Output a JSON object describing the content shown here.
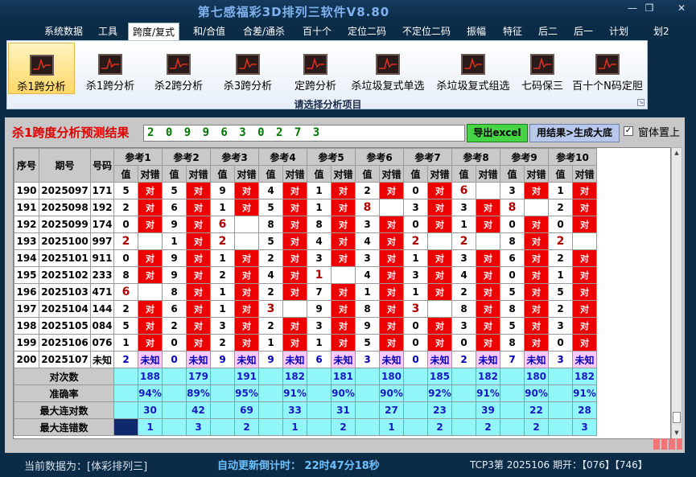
{
  "window": {
    "title": "第七感福彩3D排列三软件V8.80",
    "min": "—",
    "max": "❐",
    "close": "✕"
  },
  "menu": [
    "系统数据",
    "工具",
    "跨度/复式",
    "和/合值",
    "合差/通杀",
    "百十个",
    "定位二码",
    "不定位二码",
    "振幅",
    "特征",
    "后二",
    "后一",
    "计划",
    "划2"
  ],
  "menu_active": 2,
  "ribbon": {
    "buttons": [
      "杀1跨分析",
      "杀1跨分析",
      "杀2跨分析",
      "杀3跨分析",
      "定跨分析",
      "杀垃圾复式单选",
      "杀垃圾复式组选",
      "七码保三",
      "百十个N码定胆"
    ],
    "active": 0,
    "caption": "请选择分析项目",
    "icon": "chart-icon"
  },
  "result": {
    "label": "杀1跨度分析预测结果",
    "value": "2 0 9 9 6 3 0 2 7 3",
    "excel_button": "导出excel",
    "generate_button": "用结果>生成大底",
    "ontop_label": "窗体置上",
    "ontop_checked": "✓"
  },
  "table": {
    "col_headers": [
      "序号",
      "期号",
      "号码"
    ],
    "refs": [
      "参考1",
      "参考2",
      "参考3",
      "参考4",
      "参考5",
      "参考6",
      "参考7",
      "参考8",
      "参考9",
      "参考10"
    ],
    "sub_headers": [
      "值",
      "对错"
    ],
    "hit_text": "对",
    "unknown_text": "未知",
    "rows": [
      {
        "seq": "190",
        "period": "2025097",
        "number": "171",
        "vals": [
          "5",
          "5",
          "9",
          "4",
          "1",
          "2",
          "0",
          "6",
          "3",
          "1"
        ],
        "hits": [
          1,
          1,
          1,
          1,
          1,
          1,
          1,
          0,
          1,
          1
        ]
      },
      {
        "seq": "191",
        "period": "2025098",
        "number": "192",
        "vals": [
          "2",
          "6",
          "1",
          "5",
          "1",
          "8",
          "3",
          "3",
          "8",
          "2"
        ],
        "hits": [
          1,
          1,
          1,
          1,
          1,
          0,
          1,
          1,
          0,
          1
        ]
      },
      {
        "seq": "192",
        "period": "2025099",
        "number": "174",
        "vals": [
          "0",
          "9",
          "6",
          "8",
          "8",
          "3",
          "0",
          "1",
          "0",
          "0"
        ],
        "hits": [
          1,
          1,
          0,
          1,
          1,
          1,
          1,
          1,
          1,
          1
        ]
      },
      {
        "seq": "193",
        "period": "2025100",
        "number": "997",
        "vals": [
          "2",
          "1",
          "2",
          "5",
          "4",
          "4",
          "2",
          "2",
          "8",
          "2"
        ],
        "hits": [
          0,
          1,
          0,
          1,
          1,
          1,
          0,
          0,
          1,
          0
        ]
      },
      {
        "seq": "194",
        "period": "2025101",
        "number": "911",
        "vals": [
          "0",
          "9",
          "1",
          "2",
          "3",
          "3",
          "1",
          "3",
          "6",
          "2"
        ],
        "hits": [
          1,
          1,
          1,
          1,
          1,
          1,
          1,
          1,
          1,
          1
        ]
      },
      {
        "seq": "195",
        "period": "2025102",
        "number": "233",
        "vals": [
          "8",
          "9",
          "2",
          "4",
          "1",
          "4",
          "3",
          "4",
          "0",
          "1"
        ],
        "hits": [
          1,
          1,
          1,
          1,
          0,
          1,
          1,
          1,
          1,
          1
        ]
      },
      {
        "seq": "196",
        "period": "2025103",
        "number": "471",
        "vals": [
          "6",
          "8",
          "1",
          "2",
          "7",
          "1",
          "1",
          "2",
          "5",
          "5"
        ],
        "hits": [
          0,
          1,
          1,
          1,
          1,
          1,
          1,
          1,
          1,
          1
        ]
      },
      {
        "seq": "197",
        "period": "2025104",
        "number": "144",
        "vals": [
          "2",
          "6",
          "1",
          "3",
          "9",
          "8",
          "3",
          "8",
          "8",
          "2"
        ],
        "hits": [
          1,
          1,
          1,
          0,
          1,
          1,
          0,
          1,
          1,
          1
        ]
      },
      {
        "seq": "198",
        "period": "2025105",
        "number": "084",
        "vals": [
          "5",
          "2",
          "3",
          "2",
          "3",
          "9",
          "0",
          "3",
          "5",
          "3"
        ],
        "hits": [
          1,
          1,
          1,
          1,
          1,
          1,
          1,
          1,
          1,
          1
        ]
      },
      {
        "seq": "199",
        "period": "2025106",
        "number": "076",
        "vals": [
          "1",
          "0",
          "2",
          "1",
          "1",
          "5",
          "0",
          "0",
          "8",
          "0"
        ],
        "hits": [
          1,
          1,
          1,
          1,
          1,
          1,
          1,
          1,
          1,
          1
        ]
      }
    ],
    "unknown_row": {
      "seq": "200",
      "period": "2025107",
      "number": "未知",
      "vals": [
        "2",
        "0",
        "9",
        "9",
        "6",
        "3",
        "0",
        "2",
        "7",
        "3"
      ]
    },
    "stats": [
      {
        "label": "对次数",
        "values": [
          "188",
          "179",
          "191",
          "182",
          "181",
          "180",
          "185",
          "182",
          "180",
          "182"
        ]
      },
      {
        "label": "准确率",
        "values": [
          "94%",
          "89%",
          "95%",
          "91%",
          "90%",
          "90%",
          "92%",
          "91%",
          "90%",
          "91%"
        ]
      },
      {
        "label": "最大连对数",
        "values": [
          "30",
          "42",
          "69",
          "33",
          "31",
          "27",
          "23",
          "39",
          "22",
          "28"
        ]
      },
      {
        "label": "最大连错数",
        "values": [
          "1",
          "3",
          "2",
          "1",
          "2",
          "1",
          "2",
          "2",
          "2",
          "3"
        ]
      }
    ]
  },
  "status": {
    "left": "当前数据为：[体彩排列三]",
    "countdown": "自动更新倒计时： 22时47分18秒",
    "right": "TCP3第 2025106 期开：【076】【746】"
  }
}
